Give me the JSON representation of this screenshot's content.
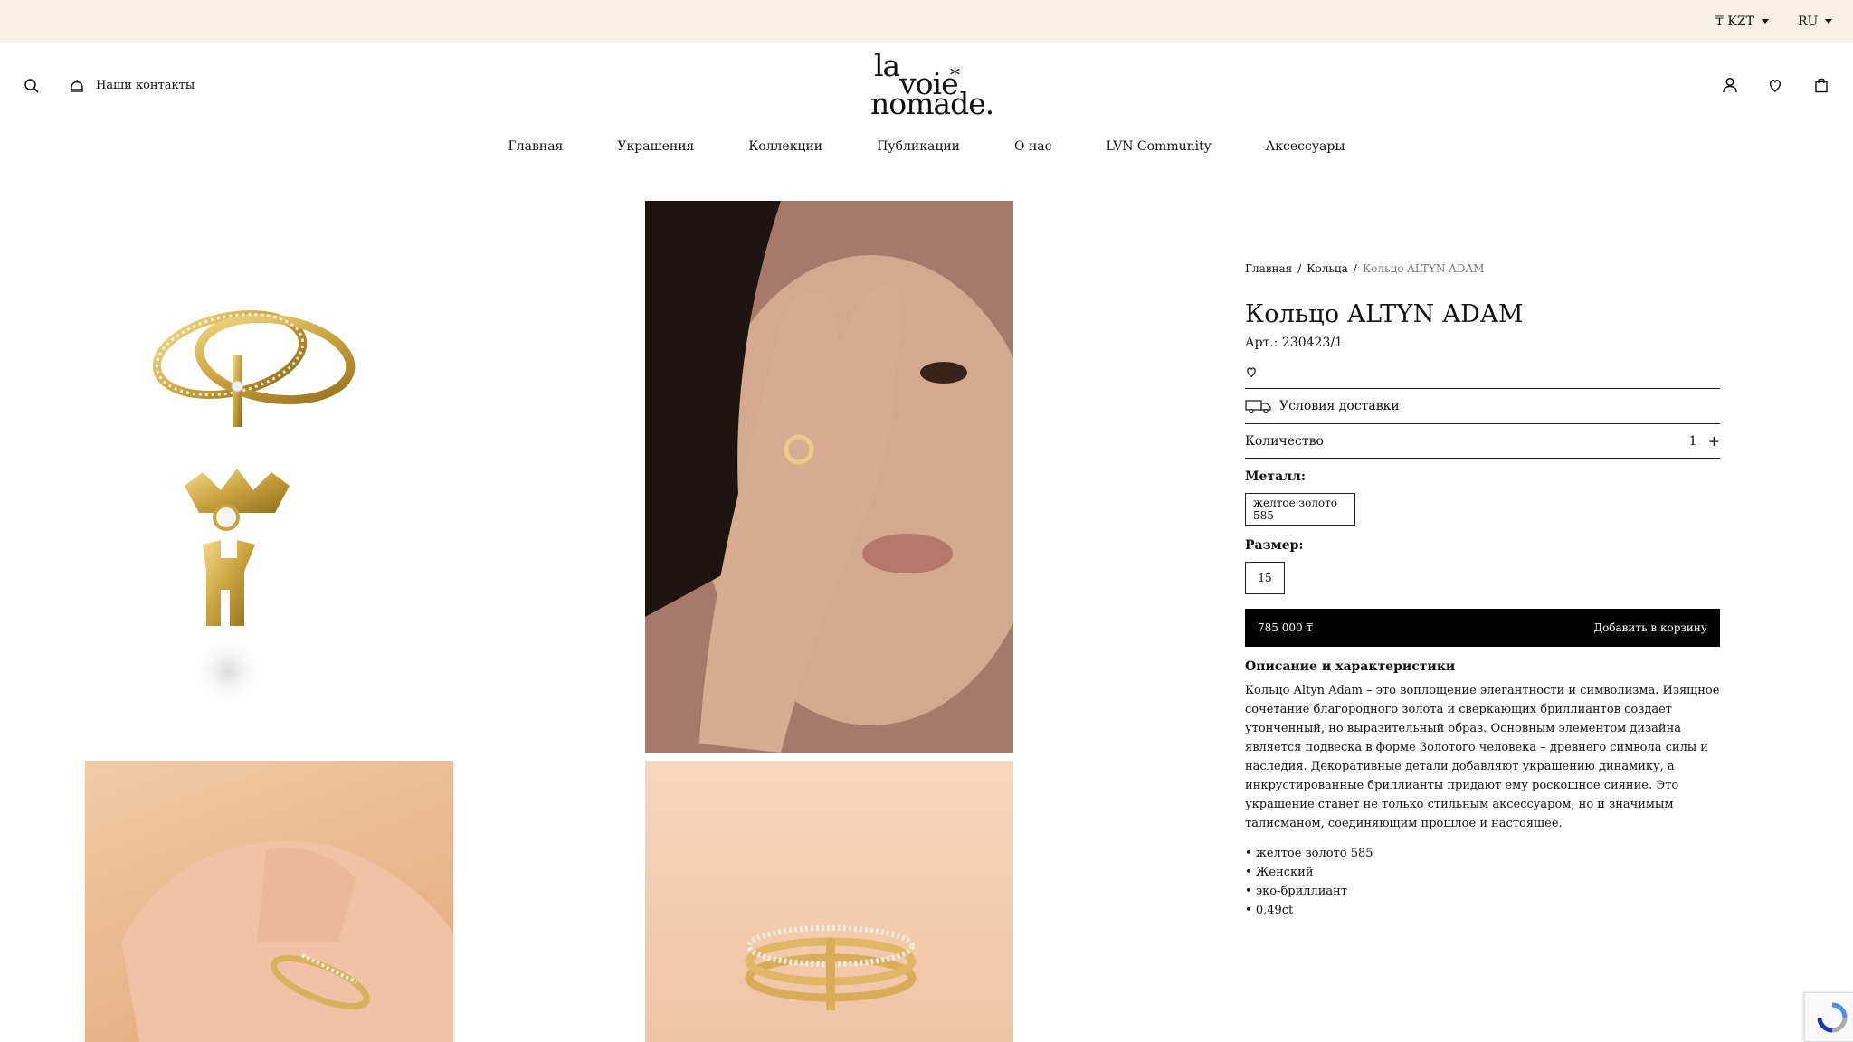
{
  "topbar": {
    "currency": "₸ KZT",
    "language": "RU",
    "bg_color": "#f8efe6"
  },
  "header": {
    "contacts_label": "Наши контакты",
    "logo": {
      "line1": "la",
      "line2": "voie",
      "star": "*",
      "line3": "nomade."
    }
  },
  "nav": {
    "items": [
      {
        "label": "Главная"
      },
      {
        "label": "Украшения"
      },
      {
        "label": "Коллекции"
      },
      {
        "label": "Публикации"
      },
      {
        "label": "О нас"
      },
      {
        "label": "LVN Community"
      },
      {
        "label": "Аксессуары"
      }
    ]
  },
  "product": {
    "breadcrumb": [
      "Главная",
      "Кольца",
      "Кольцо ALTYN ADAM"
    ],
    "title": "Кольцо ALTYN ADAM",
    "article": "Арт.: 230423/1",
    "delivery_label": "Условия доставки",
    "quantity_label": "Количество",
    "quantity_value": "1",
    "quantity_plus": "+",
    "metal_label": "Металл:",
    "metal_option": "желтое золото 585",
    "size_label": "Размер:",
    "size_option": "15",
    "price": "785 000 ₸",
    "add_to_cart": "Добавить в корзину",
    "description_title": "Описание и характеристики",
    "description": "Кольцо Altyn Adam – это воплощение элегантности и символизма. Изящное сочетание благородного золота и сверкающих бриллиантов создает утонченный, но выразительный образ. Основным элементом дизайна является подвеска в форме Золотого человека – древнего символа силы и наследия. Декоративные детали добавляют украшению динамику, а инкрустированные бриллианты придают ему роскошное сияние. Это украшение станет не только стильным аксессуаром, но и значимым талисманом, соединяющим прошлое и настоящее.",
    "specs": [
      "желтое золото 585",
      "Женский",
      "эко-бриллиант",
      "0,49ct"
    ]
  },
  "colors": {
    "accent": "#000000",
    "text": "#111111"
  }
}
